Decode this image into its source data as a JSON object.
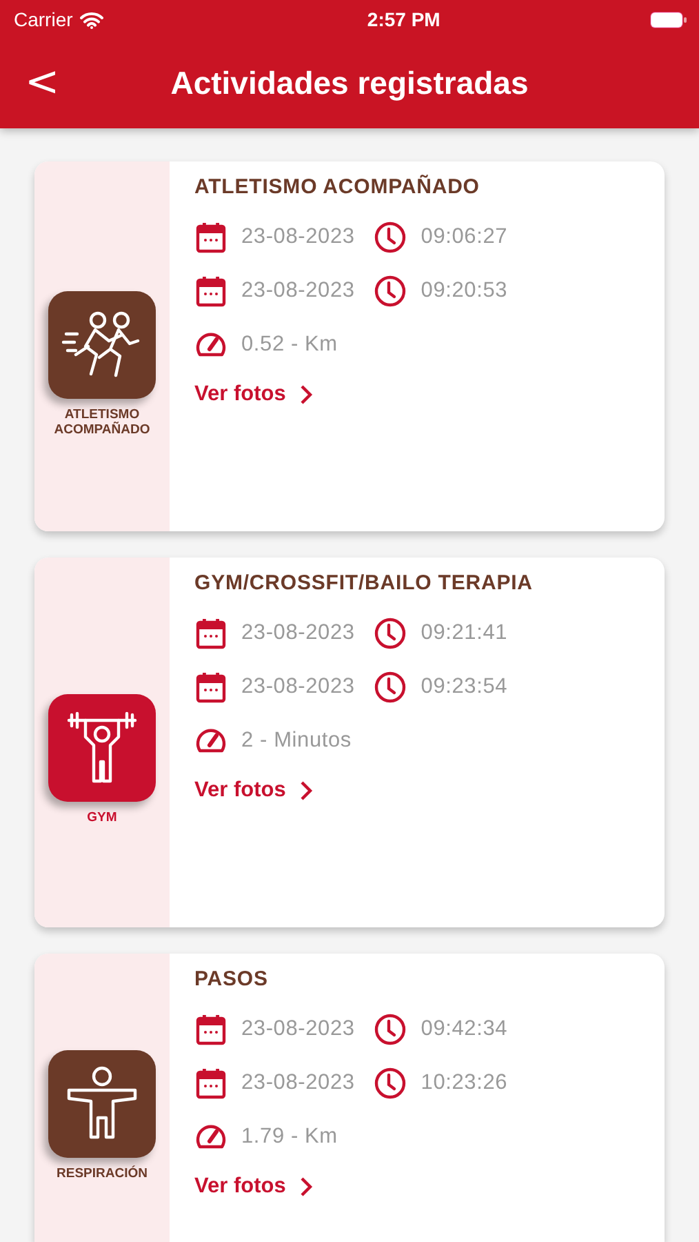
{
  "status_bar": {
    "carrier": "Carrier",
    "time": "2:57 PM"
  },
  "nav": {
    "back": "<",
    "title": "Actividades registradas"
  },
  "activities": [
    {
      "title": "ATLETISMO ACOMPAÑADO",
      "badge": {
        "kind": "running",
        "label": "ATLETISMO ACOMPAÑADO",
        "color": "#6b3a28"
      },
      "start_date": "23-08-2023",
      "start_time": "09:06:27",
      "end_date": "23-08-2023",
      "end_time": "09:20:53",
      "measure": "0.52 - Km",
      "link": "Ver fotos"
    },
    {
      "title": "GYM/CROSSFIT/BAILO TERAPIA",
      "badge": {
        "kind": "weightlifting",
        "label": "GYM",
        "color": "#c8102e"
      },
      "start_date": "23-08-2023",
      "start_time": "09:21:41",
      "end_date": "23-08-2023",
      "end_time": "09:23:54",
      "measure": "2 - Minutos",
      "link": "Ver fotos"
    },
    {
      "title": "PASOS",
      "badge": {
        "kind": "figure",
        "label": "RESPIRACIÓN",
        "color": "#6b3a28"
      },
      "start_date": "23-08-2023",
      "start_time": "09:42:34",
      "end_date": "23-08-2023",
      "end_time": "10:23:26",
      "measure": "1.79 - Km",
      "link": "Ver fotos"
    }
  ]
}
